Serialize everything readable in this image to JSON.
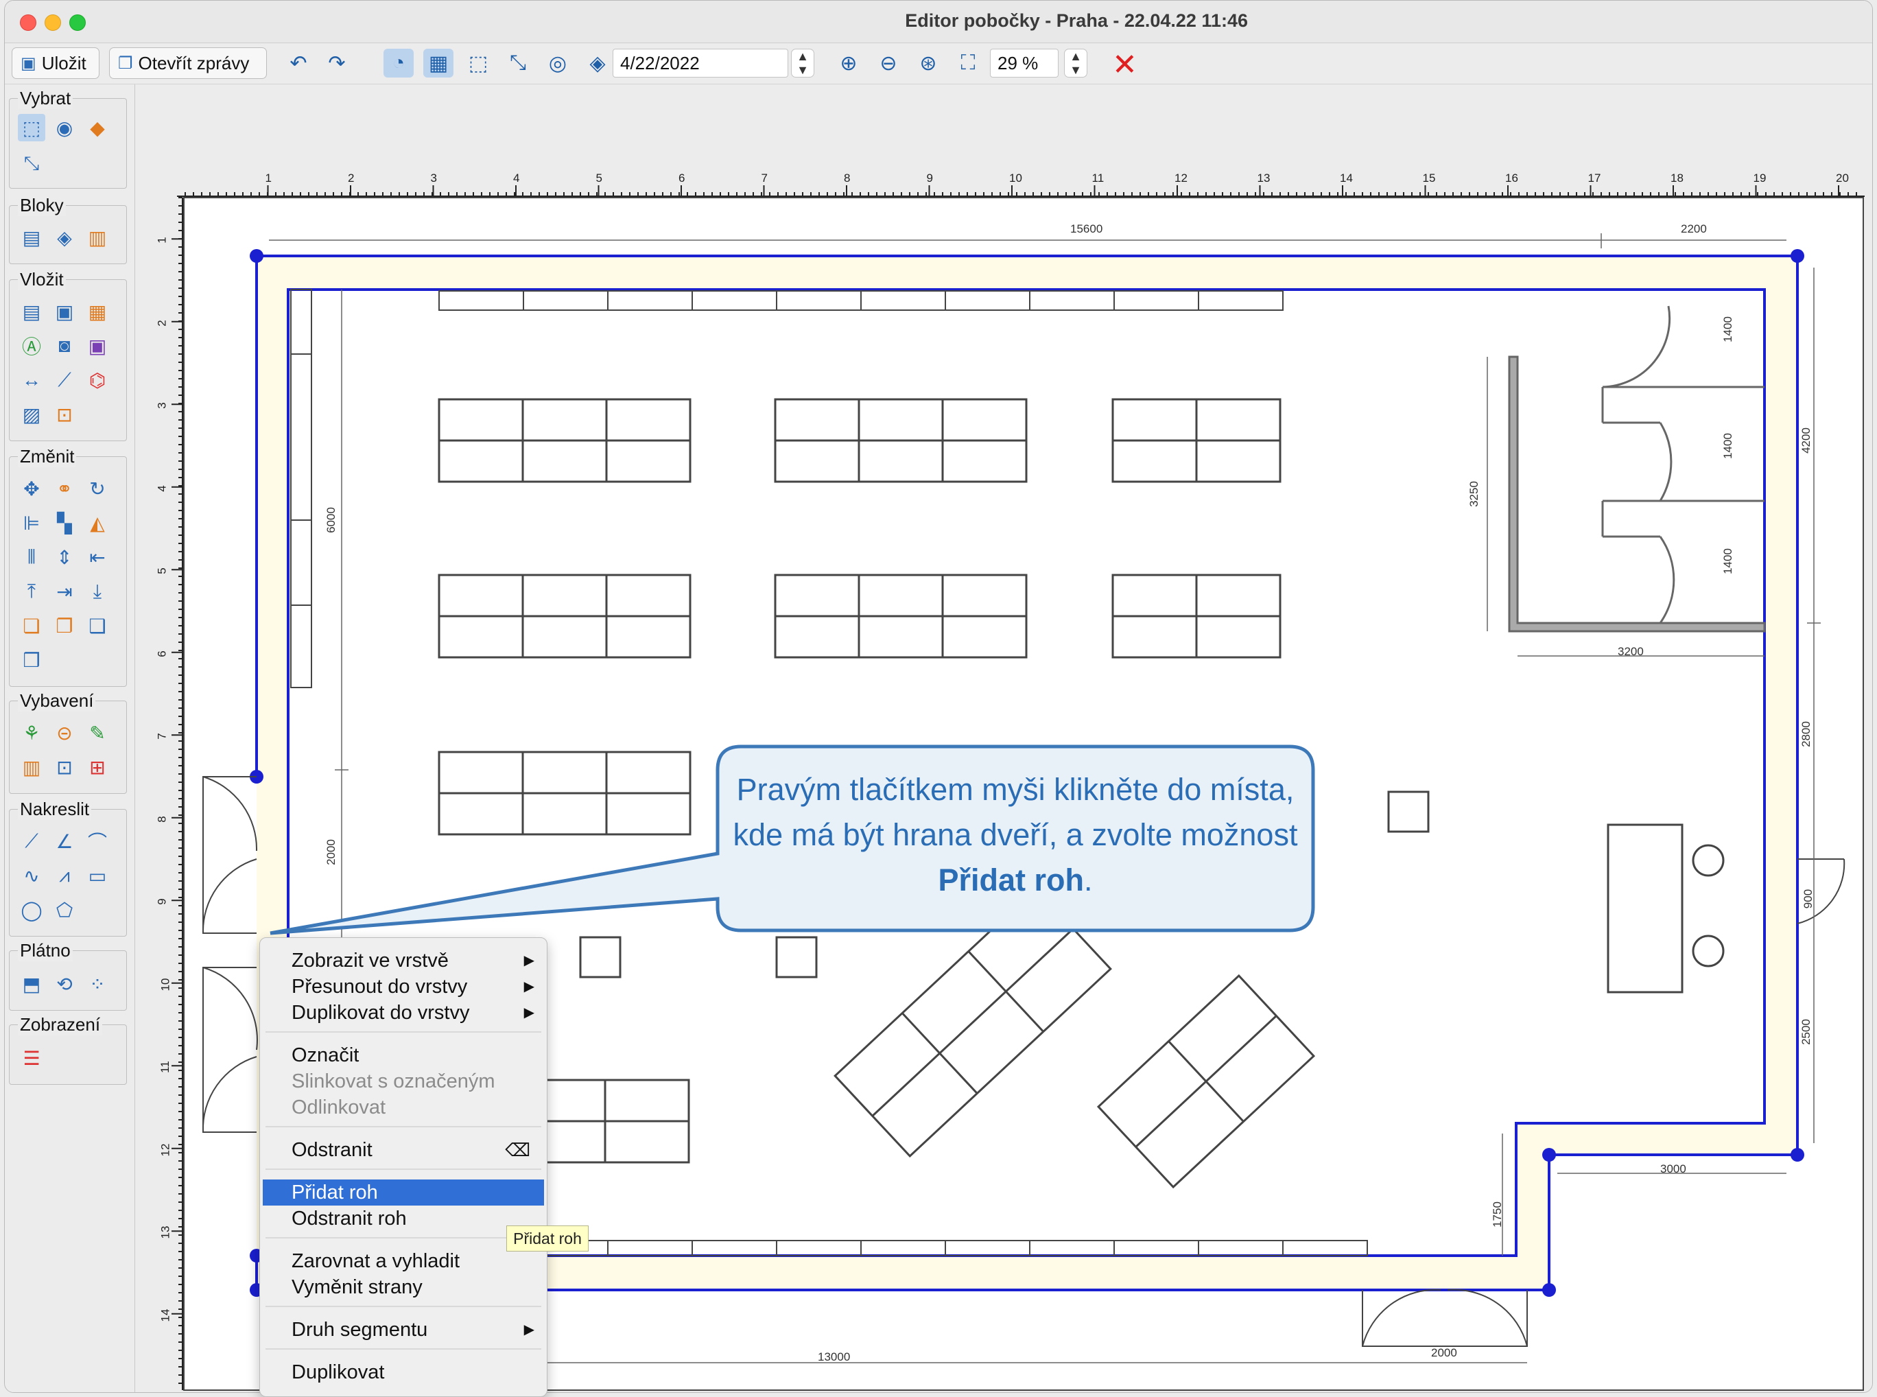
{
  "window": {
    "title": "Editor pobočky - Praha - 22.04.22 11:46"
  },
  "toolbar": {
    "save_label": "Uložit",
    "open_reports_label": "Otevřít zprávy",
    "date_value": "4/22/2022",
    "zoom_value": "29 %"
  },
  "sidebar": {
    "groups": [
      {
        "label": "Vybrat"
      },
      {
        "label": "Bloky"
      },
      {
        "label": "Vložit"
      },
      {
        "label": "Změnit"
      },
      {
        "label": "Vybavení"
      },
      {
        "label": "Nakreslit"
      },
      {
        "label": "Plátno"
      },
      {
        "label": "Zobrazení"
      }
    ]
  },
  "ruler": {
    "horizontal": [
      "1",
      "2",
      "3",
      "4",
      "5",
      "6",
      "7",
      "8",
      "9",
      "10",
      "11",
      "12",
      "13",
      "14",
      "15",
      "16",
      "17",
      "18",
      "19",
      "20"
    ],
    "vertical": [
      "1",
      "2",
      "3",
      "4",
      "5",
      "6",
      "7",
      "8",
      "9",
      "10",
      "11",
      "12",
      "13",
      "14"
    ]
  },
  "dimensions": {
    "top_left": "15600",
    "top_right": "2200",
    "right_1400_a": "1400",
    "right_1400_b": "1400",
    "right_1400_c": "1400",
    "right_4200": "4200",
    "right_2800": "2800",
    "right_900": "900",
    "right_2500": "2500",
    "left_6000": "6000",
    "left_2000": "2000",
    "room_3250": "3250",
    "room_3200": "3200",
    "bottom_3000": "3000",
    "bottom_1750": "1750",
    "bottom_13000": "13000",
    "bottom_2000": "2000"
  },
  "callout": {
    "text_before": "Pravým tlačítkem myši klikněte do místa, kde má být hrana dveří, a zvolte možnost ",
    "text_bold": "Přidat roh",
    "text_after": "."
  },
  "context_menu": {
    "show_in_layer": "Zobrazit ve vrstvě",
    "move_to_layer": "Přesunout do vrstvy",
    "duplicate_to_layer": "Duplikovat do vrstvy",
    "select": "Označit",
    "link_with_selected": "Slinkovat s označeným",
    "unlink": "Odlinkovat",
    "delete": "Odstranit",
    "add_corner": "Přidat roh",
    "remove_corner": "Odstranit roh",
    "align_smooth": "Zarovnat a vyhladit",
    "swap_sides": "Vyměnit strany",
    "segment_type": "Druh segmentu",
    "duplicate": "Duplikovat"
  },
  "tooltip": {
    "text": "Přidat roh"
  },
  "colors": {
    "wall": "#1a1fcf",
    "accent": "#2f6fd6",
    "callout_border": "#3d78b8",
    "callout_fill": "#e8f0f8"
  }
}
